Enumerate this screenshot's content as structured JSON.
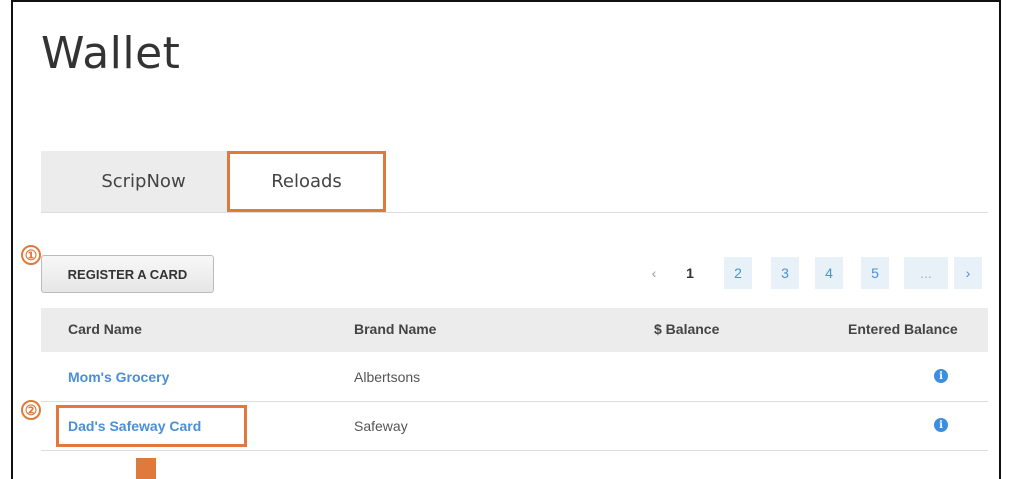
{
  "page": {
    "title": "Wallet"
  },
  "tabs": [
    {
      "label": "ScripNow"
    },
    {
      "label": "Reloads"
    }
  ],
  "toolbar": {
    "register_label": "REGISTER A CARD"
  },
  "callouts": {
    "one": "①",
    "two": "②"
  },
  "pagination": {
    "prev": "‹",
    "pages": [
      "1",
      "2",
      "3",
      "4",
      "5"
    ],
    "ellipsis": "...",
    "next": "›",
    "current": "1"
  },
  "table": {
    "headers": [
      "Card Name",
      "Brand Name",
      "$ Balance",
      "Entered Balance"
    ],
    "rows": [
      {
        "card_name": "Mom's Grocery",
        "brand_name": "Albertsons",
        "balance": "",
        "entered_balance_icon": "info-icon"
      },
      {
        "card_name": "Dad's Safeway Card",
        "brand_name": "Safeway",
        "balance": "",
        "entered_balance_icon": "info-icon"
      }
    ]
  },
  "colors": {
    "accent": "#e07a3c",
    "link": "#4a8fd6",
    "info": "#3c8ede"
  },
  "icons": {
    "info": "i"
  }
}
